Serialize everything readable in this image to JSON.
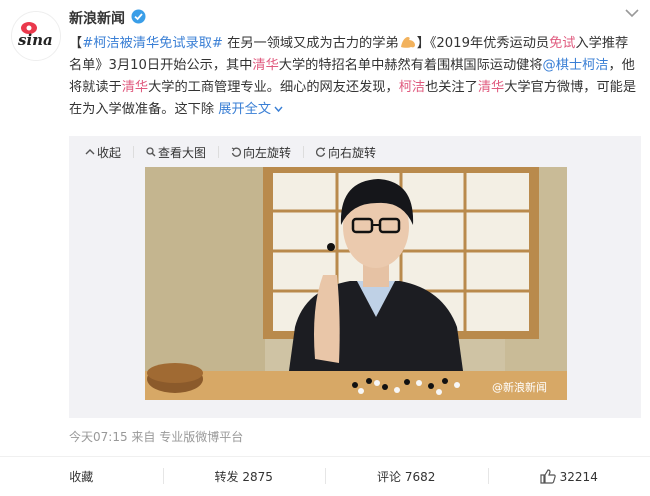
{
  "post": {
    "username": "新浪新闻",
    "avatar_text": "sina",
    "content": {
      "bracket_open": "【",
      "topic": "#柯洁被清华免试录取#",
      "lead": " 在另一领域又成为古力的学弟",
      "bracket_close": "】《2019年优秀运动员",
      "free_exam": "免试",
      "text2": "入学推荐名单》3月10日开始公示，其中",
      "tsinghua1": "清华",
      "text3": "大学的特招名单中赫然有着围棋国际运动健将",
      "mention": "@棋士柯洁",
      "text4": "，他将就读于",
      "tsinghua2": "清华",
      "text5": "大学的工商管理专业。细心的网友还发现，",
      "kejie": "柯洁",
      "text6": "也关注了",
      "tsinghua3": "清华",
      "text7": "大学官方微博，可能是在为入学做准备。这下除",
      "expand": "展开全文"
    },
    "media_tools": [
      "收起",
      "查看大图",
      "向左旋转",
      "向右旋转"
    ],
    "watermark": "@新浪新闻",
    "time": "今天07:15",
    "from_label": "来自",
    "source": "专业版微博平台"
  },
  "actions": {
    "favorite": "收藏",
    "repost_label": "转发",
    "repost_count": "2875",
    "comment_label": "评论",
    "comment_count": "7682",
    "like_count": "32214"
  },
  "colors": {
    "highlight_red": "#e05b7f",
    "link_blue": "#3a7fd5",
    "meta_gray": "#999999"
  }
}
